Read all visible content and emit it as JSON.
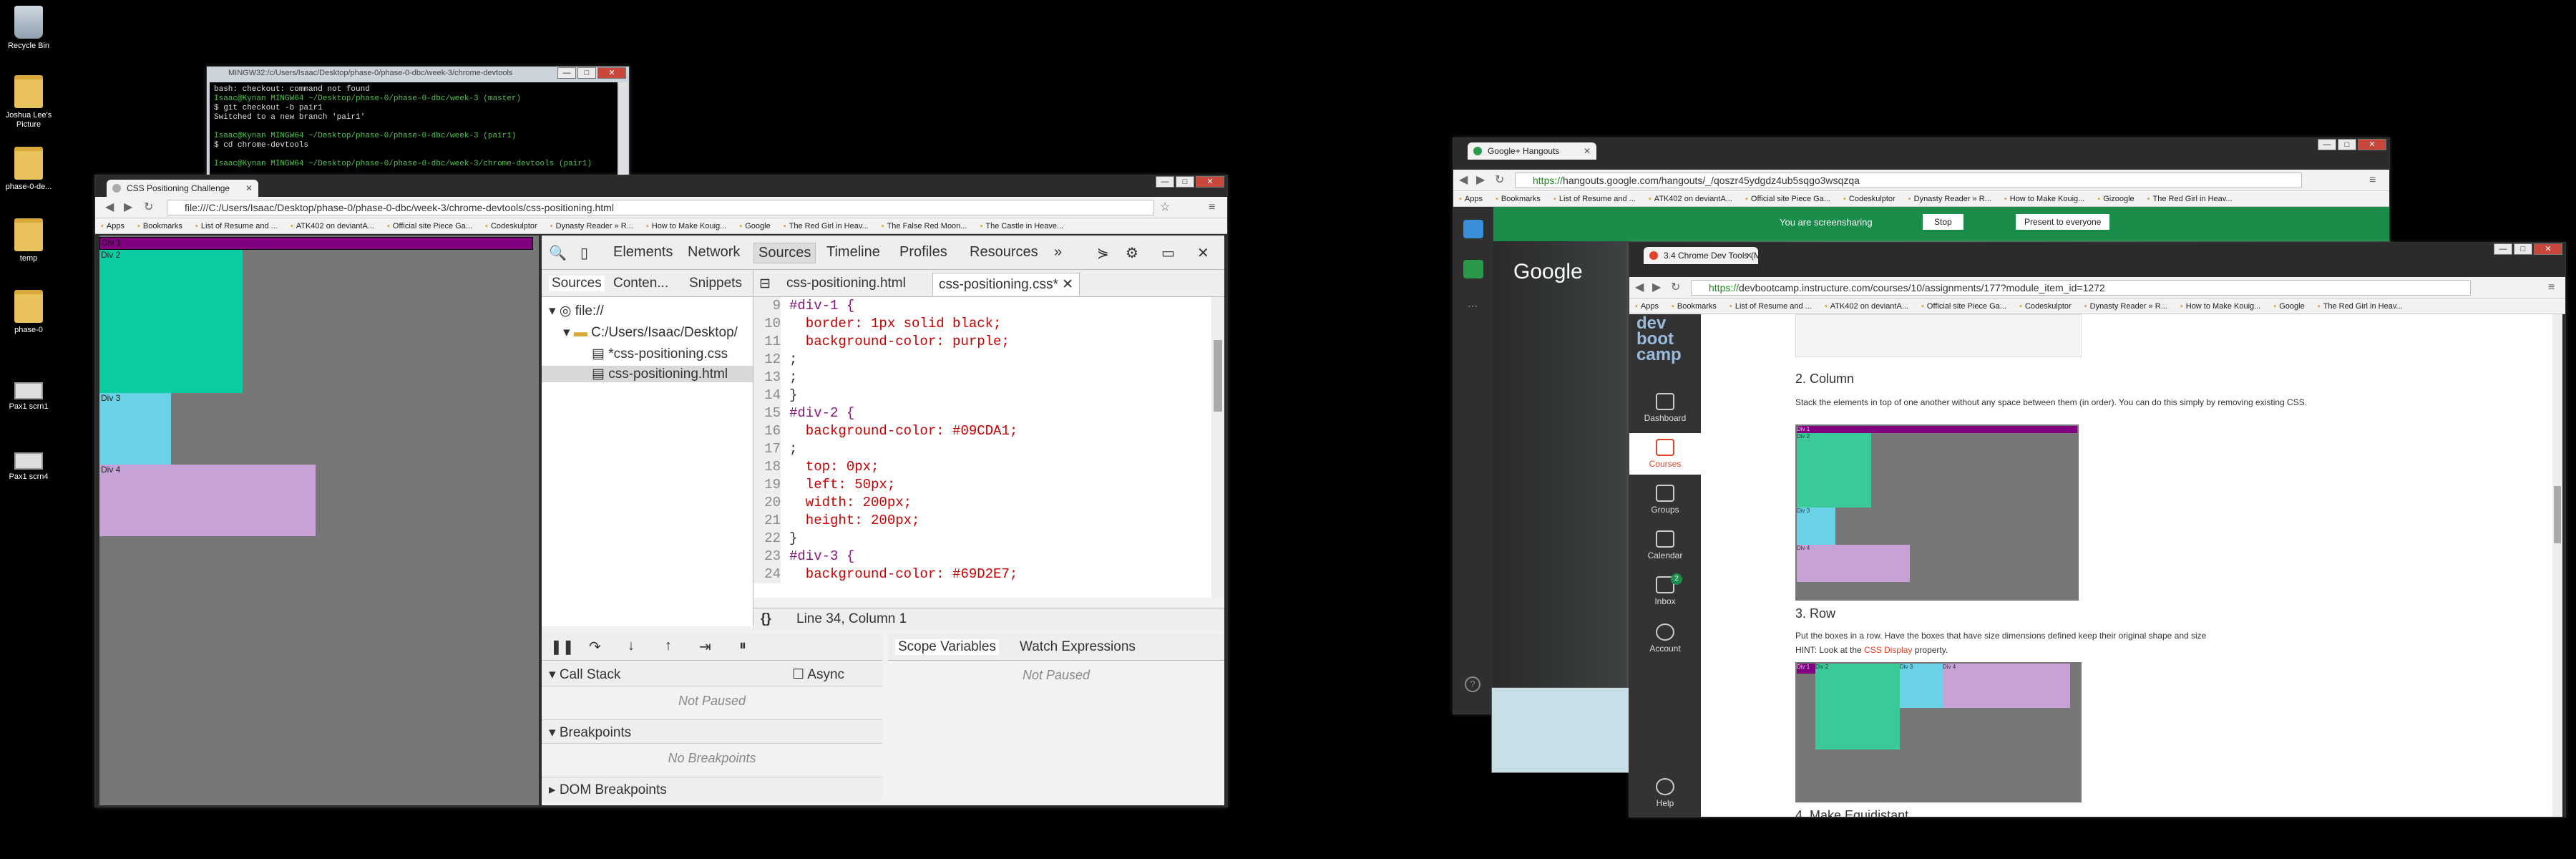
{
  "desktop": {
    "icons": [
      {
        "label": "Recycle Bin"
      },
      {
        "label": "Joshua Lee's Picture"
      },
      {
        "label": "phase-0-de..."
      },
      {
        "label": "temp"
      },
      {
        "label": "phase-0"
      },
      {
        "label": "Pax1 scrn1"
      },
      {
        "label": "Pax1 scrn4"
      }
    ]
  },
  "terminal": {
    "title": "MINGW32:/c/Users/Isaac/Desktop/phase-0/phase-0-dbc/week-3/chrome-devtools",
    "lines": [
      {
        "t": "bash: checkout: command not found",
        "c": ""
      },
      {
        "t": "Isaac@Kynan MINGW64 ~/Desktop/phase-0/phase-0-dbc/week-3 (master)",
        "c": "g"
      },
      {
        "t": "$ git checkout -b pair1",
        "c": ""
      },
      {
        "t": "Switched to a new branch 'pair1'",
        "c": ""
      },
      {
        "t": "",
        "c": ""
      },
      {
        "t": "Isaac@Kynan MINGW64 ~/Desktop/phase-0/phase-0-dbc/week-3 (pair1)",
        "c": "g"
      },
      {
        "t": "$ cd chrome-devtools",
        "c": ""
      },
      {
        "t": "",
        "c": ""
      },
      {
        "t": "Isaac@Kynan MINGW64 ~/Desktop/phase-0/phase-0-dbc/week-3/chrome-devtools (pair1)",
        "c": "g"
      }
    ]
  },
  "left_browser": {
    "tab_title": "CSS Positioning Challenge",
    "url": "file:///C:/Users/Isaac/Desktop/phase-0/phase-0-dbc/week-3/chrome-devtools/css-positioning.html",
    "bookmarks": [
      "Apps",
      "Bookmarks",
      "List of Resume and ...",
      "ATK402 on deviantA...",
      "Official site Piece Ga...",
      "Codeskulptor",
      "Dynasty Reader » R...",
      "How to Make Kouig...",
      "Google",
      "The Red Girl in Heav...",
      "The False Red Moon...",
      "The Castle in Heave..."
    ],
    "page": {
      "div1": "Div 1",
      "div2": "Div 2",
      "div3": "Div 3",
      "div4": "Div 4"
    },
    "devtools": {
      "panels": [
        "Elements",
        "Network",
        "Sources",
        "Timeline",
        "Profiles",
        "Resources",
        "»"
      ],
      "nav_tabs": [
        "Sources",
        "Conten...",
        "Snippets"
      ],
      "file_tree": [
        "file://",
        "C:/Users/Isaac/Desktop/",
        "*css-positioning.css",
        "css-positioning.html"
      ],
      "editor_tabs": [
        "css-positioning.html",
        "css-positioning.css*"
      ],
      "code": [
        {
          "n": "9",
          "t": "#div-1 {"
        },
        {
          "n": "10",
          "t": "  border: 1px solid black;"
        },
        {
          "n": "11",
          "t": "  background-color: purple;"
        },
        {
          "n": "12",
          "t": ";"
        },
        {
          "n": "13",
          "t": ";"
        },
        {
          "n": "14",
          "t": "}"
        },
        {
          "n": "15",
          "t": "#div-2 {"
        },
        {
          "n": "16",
          "t": "  background-color: #09CDA1;"
        },
        {
          "n": "17",
          "t": ";"
        },
        {
          "n": "18",
          "t": "  top: 0px;"
        },
        {
          "n": "19",
          "t": "  left: 50px;"
        },
        {
          "n": "20",
          "t": "  width: 200px;"
        },
        {
          "n": "21",
          "t": "  height: 200px;"
        },
        {
          "n": "22",
          "t": "}"
        },
        {
          "n": "23",
          "t": "#div-3 {"
        },
        {
          "n": "24",
          "t": "  background-color: #69D2E7;"
        }
      ],
      "status": "Line 34, Column 1",
      "format_label": "{}",
      "call_stack": "Call Stack",
      "async": "Async",
      "not_paused": "Not Paused",
      "breakpoints": "Breakpoints",
      "no_breakpoints": "No Breakpoints",
      "dom_breakpoints": "DOM Breakpoints",
      "scope_variables": "Scope Variables",
      "watch_expressions": "Watch Expressions",
      "scope_not_paused": "Not Paused"
    }
  },
  "hangouts_browser": {
    "tab_title": "Google+ Hangouts",
    "url_https": "https://",
    "url": "hangouts.google.com/hangouts/_/qoszr45ydgdz4ub5sqgo3wsqzqa",
    "bookmarks": [
      "Apps",
      "Bookmarks",
      "List of Resume and ...",
      "ATK402 on deviantA...",
      "Official site Piece Ga...",
      "Codeskulptor",
      "Dynasty Reader » R...",
      "How to Make Kouig...",
      "Gizoogle",
      "The Red Girl in Heav..."
    ],
    "screenshare_text": "You are screensharing",
    "stop": "Stop",
    "present": "Present to everyone",
    "google_logo": "Google"
  },
  "canvas_browser": {
    "tab_title": "3.4 Chrome Dev Tools (M...",
    "url_https": "https://",
    "url": "devbootcamp.instructure.com/courses/10/assignments/177?module_item_id=1272",
    "bookmarks": [
      "Apps",
      "Bookmarks",
      "List of Resume and ...",
      "ATK402 on deviantA...",
      "Official site Piece Ga...",
      "Codeskulptor",
      "Dynasty Reader » R...",
      "How to Make Kouig...",
      "Google",
      "The Red Girl in Heav..."
    ],
    "logo": [
      "dev",
      "boot",
      "camp"
    ],
    "nav": [
      "Dashboard",
      "Courses",
      "Groups",
      "Calendar",
      "Inbox",
      "Account",
      "Help"
    ],
    "inbox_badge": "2",
    "sections": {
      "col_title": "2. Column",
      "col_desc": "Stack the elements in top of one another without any space between them (in order). You can do this simply by removing existing CSS.",
      "row_title": "3. Row",
      "row_desc": "Put the boxes in a row. Have the boxes that have size dimensions defined keep their original shape and size",
      "row_hint": "HINT: Look at the ",
      "row_link": "CSS Display",
      "row_hint_end": " property.",
      "equi_title": "4. Make Equidistant"
    },
    "demo_labels": {
      "d1": "Div 1",
      "d2": "Div 2",
      "d3": "Div 3",
      "d4": "Div 4"
    }
  },
  "colors": {
    "div1": "#800080",
    "div2": "#09CDA1",
    "div3": "#69D2E7",
    "div4": "#C7A2D6",
    "canvas_green": "#1b8d4a"
  }
}
